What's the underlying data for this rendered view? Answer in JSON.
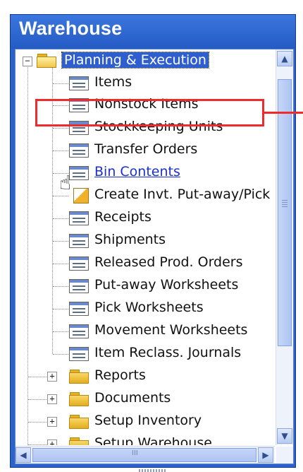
{
  "window": {
    "title": "Warehouse"
  },
  "tree": {
    "root": {
      "label": "Planning & Execution",
      "expander": "−",
      "icon": "open-folder-icon"
    },
    "items": [
      {
        "label": "Items",
        "icon": "form-icon"
      },
      {
        "label": "Nonstock Items",
        "icon": "form-icon"
      },
      {
        "label": "Stockkeeping Units",
        "icon": "form-icon"
      },
      {
        "label": "Transfer Orders",
        "icon": "form-icon"
      },
      {
        "label": "Bin Contents",
        "icon": "form-icon"
      },
      {
        "label": "Create Invt. Put-away/Pick",
        "icon": "batch-icon"
      },
      {
        "label": "Receipts",
        "icon": "form-icon"
      },
      {
        "label": "Shipments",
        "icon": "form-icon"
      },
      {
        "label": "Released Prod. Orders",
        "icon": "form-icon"
      },
      {
        "label": "Put-away Worksheets",
        "icon": "form-icon"
      },
      {
        "label": "Pick Worksheets",
        "icon": "form-icon"
      },
      {
        "label": "Movement Worksheets",
        "icon": "form-icon"
      },
      {
        "label": "Item Reclass. Journals",
        "icon": "form-icon"
      }
    ],
    "folders": [
      {
        "label": "Reports",
        "expander": "+"
      },
      {
        "label": "Documents",
        "expander": "+"
      },
      {
        "label": "Setup Inventory",
        "expander": "+"
      },
      {
        "label": "Setup Warehouse",
        "expander": "+"
      }
    ]
  },
  "scrollbars": {
    "up_arrow": "▲",
    "down_arrow": "▼",
    "left_arrow": "◀",
    "right_arrow": "▶",
    "h_thumb_grip": "III"
  },
  "colors": {
    "title_bar": "#2c62c9",
    "title_text": "#ffffff",
    "selection": "#2f5fcf",
    "link": "#1a2fd6",
    "highlight_box": "#ef2b2b"
  }
}
